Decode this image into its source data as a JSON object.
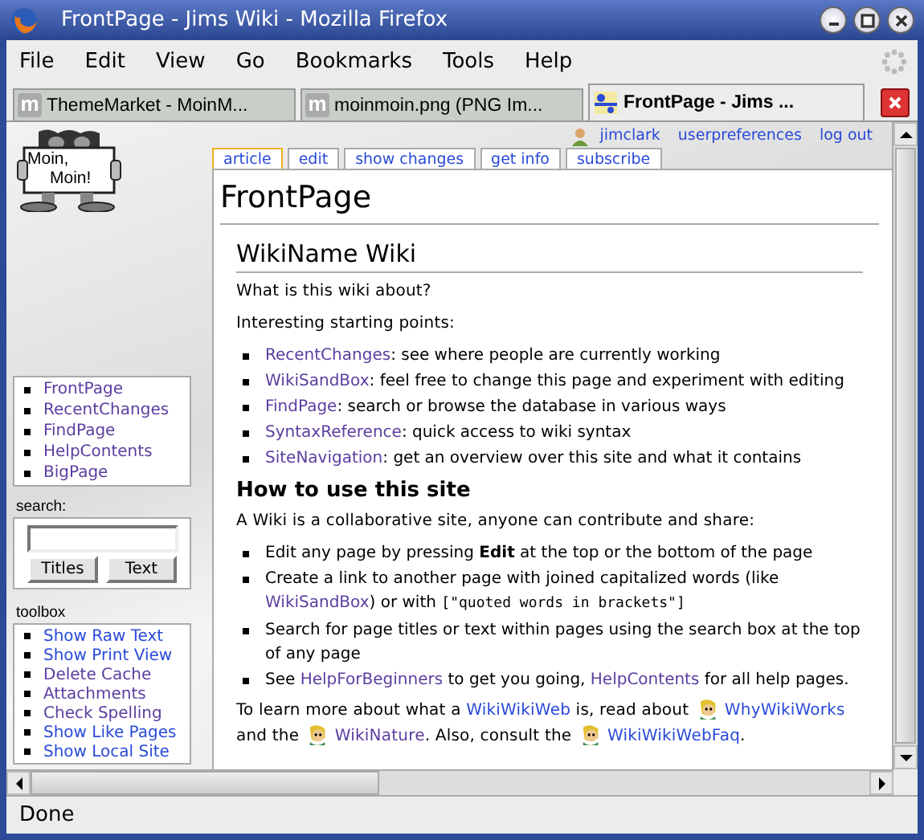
{
  "window": {
    "title": "FrontPage - Jims Wiki - Mozilla Firefox"
  },
  "menu": [
    "File",
    "Edit",
    "View",
    "Go",
    "Bookmarks",
    "Tools",
    "Help"
  ],
  "browser_tabs": [
    {
      "label": "ThemeMarket - MoinM...",
      "letter": "m",
      "selected": false
    },
    {
      "label": "moinmoin.png (PNG Im...",
      "letter": "m",
      "selected": false
    },
    {
      "label": "FrontPage - Jims ...",
      "selected": true
    }
  ],
  "logo": {
    "lines": [
      "Moin,",
      "Moin!"
    ]
  },
  "navigation": [
    {
      "label": "FrontPage",
      "visited": true
    },
    {
      "label": "RecentChanges",
      "visited": true
    },
    {
      "label": "FindPage",
      "visited": true
    },
    {
      "label": "HelpContents",
      "visited": true
    },
    {
      "label": "BigPage",
      "visited": true
    }
  ],
  "search": {
    "label": "search:",
    "buttons": [
      "Titles",
      "Text"
    ]
  },
  "toolbox": {
    "label": "toolbox",
    "items": [
      {
        "label": "Show Raw Text",
        "visited": false
      },
      {
        "label": "Show Print View",
        "visited": false
      },
      {
        "label": "Delete Cache",
        "visited": true
      },
      {
        "label": "Attachments",
        "visited": true
      },
      {
        "label": "Check Spelling",
        "visited": true
      },
      {
        "label": "Show Like Pages",
        "visited": false
      },
      {
        "label": "Show Local Site",
        "visited": false
      }
    ]
  },
  "user_links": [
    "jimclark",
    "userpreferences",
    "log out"
  ],
  "page_tabs": [
    {
      "label": "article",
      "selected": true
    },
    {
      "label": "edit",
      "selected": false
    },
    {
      "label": "show changes",
      "selected": false
    },
    {
      "label": "get info",
      "selected": false
    },
    {
      "label": "subscribe",
      "selected": false
    }
  ],
  "page": {
    "title": "FrontPage",
    "blocks": [
      {
        "kind": "h2",
        "text": "WikiName Wiki"
      },
      {
        "kind": "p",
        "segments": [
          {
            "kind": "text",
            "text": "What is this wiki about?"
          }
        ]
      },
      {
        "kind": "p",
        "segments": [
          {
            "kind": "text",
            "text": "Interesting starting points:"
          }
        ]
      },
      {
        "kind": "list",
        "items": [
          [
            {
              "kind": "link",
              "text": "RecentChanges",
              "visited": true
            },
            {
              "kind": "text",
              "text": ": see where people are currently working"
            }
          ],
          [
            {
              "kind": "link",
              "text": "WikiSandBox",
              "visited": true
            },
            {
              "kind": "text",
              "text": ": feel free to change this page and experiment with editing"
            }
          ],
          [
            {
              "kind": "link",
              "text": "FindPage",
              "visited": true
            },
            {
              "kind": "text",
              "text": ": search or browse the database in various ways"
            }
          ],
          [
            {
              "kind": "link",
              "text": "SyntaxReference",
              "visited": true
            },
            {
              "kind": "text",
              "text": ": quick access to wiki syntax"
            }
          ],
          [
            {
              "kind": "link",
              "text": "SiteNavigation",
              "visited": true
            },
            {
              "kind": "text",
              "text": ": get an overview over this site and what it contains"
            }
          ]
        ]
      },
      {
        "kind": "h3",
        "text": "How to use this site"
      },
      {
        "kind": "p",
        "segments": [
          {
            "kind": "text",
            "text": "A Wiki is a collaborative site, anyone can contribute and share:"
          }
        ]
      },
      {
        "kind": "list",
        "items": [
          [
            {
              "kind": "text",
              "text": "Edit any page by pressing "
            },
            {
              "kind": "bold",
              "text": "Edit"
            },
            {
              "kind": "text",
              "text": " at the top or the bottom of the page"
            }
          ],
          [
            {
              "kind": "text",
              "text": "Create a link to another page with joined capitalized words (like "
            },
            {
              "kind": "link",
              "text": "WikiSandBox",
              "visited": true
            },
            {
              "kind": "text",
              "text": ") or with "
            },
            {
              "kind": "code",
              "text": "[\"quoted words in brackets\"]"
            }
          ],
          [
            {
              "kind": "text",
              "text": "Search for page titles or text within pages using the search box at the top of any page"
            }
          ],
          [
            {
              "kind": "text",
              "text": "See "
            },
            {
              "kind": "link",
              "text": "HelpForBeginners",
              "visited": true
            },
            {
              "kind": "text",
              "text": " to get you going, "
            },
            {
              "kind": "link",
              "text": "HelpContents",
              "visited": true
            },
            {
              "kind": "text",
              "text": " for all help pages."
            }
          ]
        ]
      },
      {
        "kind": "p",
        "segments": [
          {
            "kind": "text",
            "text": "To learn more about what a "
          },
          {
            "kind": "link",
            "text": "WikiWikiWeb",
            "visited": false
          },
          {
            "kind": "text",
            "text": " is, read about "
          },
          {
            "kind": "smiley"
          },
          {
            "kind": "link",
            "text": "WhyWikiWorks",
            "visited": false
          },
          {
            "kind": "text",
            "text": " and the "
          },
          {
            "kind": "smiley"
          },
          {
            "kind": "link",
            "text": "WikiNature",
            "visited": true
          },
          {
            "kind": "text",
            "text": ". Also, consult the "
          },
          {
            "kind": "smiley"
          },
          {
            "kind": "link",
            "text": "WikiWikiWebFaq",
            "visited": false
          },
          {
            "kind": "text",
            "text": "."
          }
        ]
      }
    ]
  },
  "status_bar": {
    "text": "Done"
  }
}
